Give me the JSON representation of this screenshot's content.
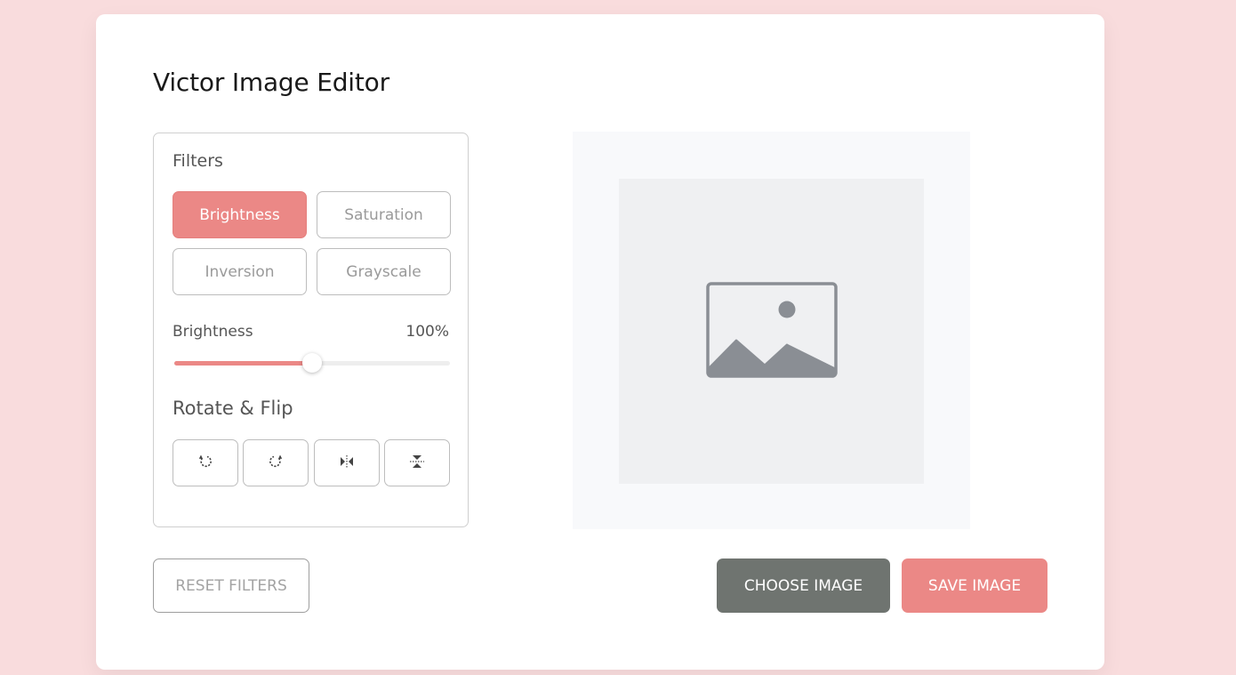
{
  "app": {
    "title": "Victor Image Editor"
  },
  "filters": {
    "label": "Filters",
    "options": [
      {
        "label": "Brightness",
        "active": true
      },
      {
        "label": "Saturation",
        "active": false
      },
      {
        "label": "Inversion",
        "active": false
      },
      {
        "label": "Grayscale",
        "active": false
      }
    ]
  },
  "slider": {
    "name": "Brightness",
    "value_text": "100%",
    "level_fraction": 0.5
  },
  "rotate": {
    "label": "Rotate & Flip",
    "buttons": [
      {
        "icon": "rotate-left-icon"
      },
      {
        "icon": "rotate-right-icon"
      },
      {
        "icon": "flip-horizontal-icon"
      },
      {
        "icon": "flip-vertical-icon"
      }
    ]
  },
  "preview": {
    "icon": "image-placeholder-icon"
  },
  "actions": {
    "reset_label": "RESET FILTERS",
    "choose_label": "CHOOSE IMAGE",
    "save_label": "SAVE IMAGE"
  },
  "colors": {
    "accent": "#eb8886",
    "background": "#f9dcdd",
    "choose_button": "#6f7470"
  }
}
